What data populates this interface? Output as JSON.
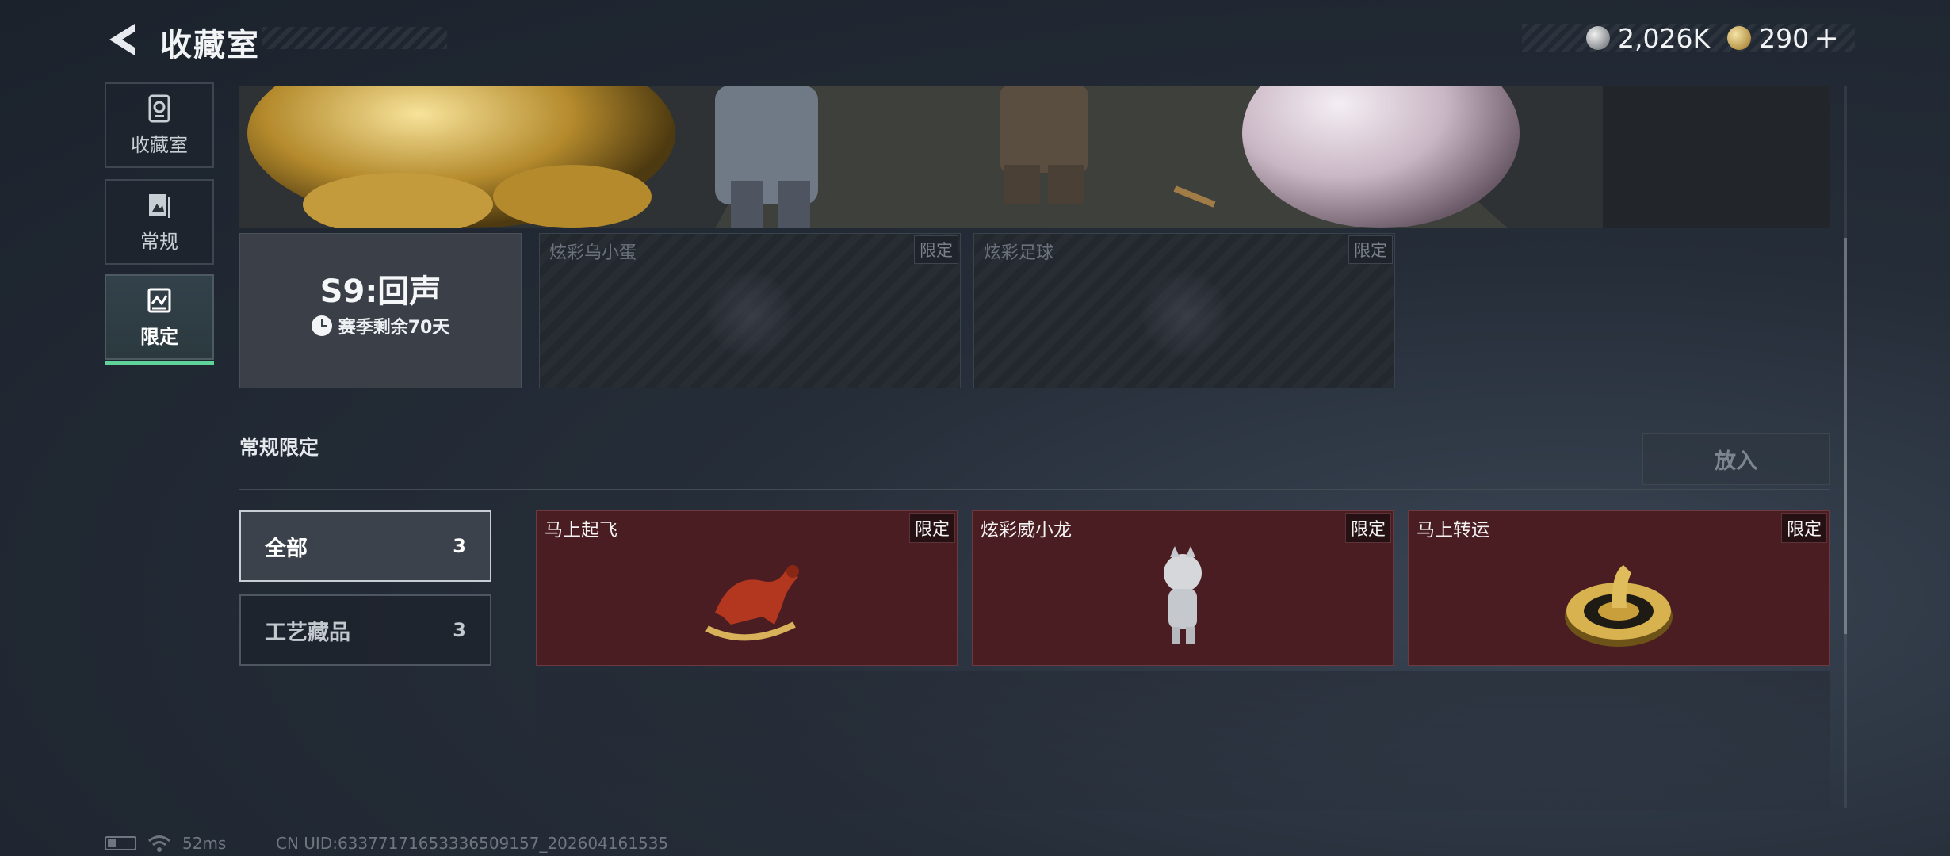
{
  "header": {
    "title": "收藏室",
    "currency": [
      {
        "icon": "silver-coin-icon",
        "value": "2,026K"
      },
      {
        "icon": "gold-coin-icon",
        "value": "290"
      }
    ],
    "add_label": "+"
  },
  "sidebar": {
    "items": [
      {
        "label": "收藏室",
        "icon": "trophy-icon"
      },
      {
        "label": "常规",
        "icon": "gallery-icon"
      },
      {
        "label": "限定",
        "icon": "limited-icon",
        "active": true
      }
    ]
  },
  "season": {
    "name": "S9:回声",
    "remaining": "赛季剩余70天"
  },
  "season_items": [
    {
      "name": "炫彩乌小蛋",
      "tag": "限定"
    },
    {
      "name": "炫彩足球",
      "tag": "限定"
    }
  ],
  "section": {
    "title": "常规限定",
    "place_button": "放入"
  },
  "filters": [
    {
      "label": "全部",
      "count": "3",
      "active": true
    },
    {
      "label": "工艺藏品",
      "count": "3",
      "active": false
    }
  ],
  "items": [
    {
      "name": "马上起飞",
      "tag": "限定",
      "art": "horse-figurine-icon"
    },
    {
      "name": "炫彩威小龙",
      "tag": "限定",
      "art": "dragon-figurine-icon"
    },
    {
      "name": "马上转运",
      "tag": "限定",
      "art": "fortune-wheel-icon"
    }
  ],
  "footer": {
    "ping": "52ms",
    "uid": "CN UID:6337717165333650915​7_202604161535"
  },
  "colors": {
    "accent": "#5fd39a",
    "item_card_bg": "#4a1d22",
    "background": "#252d38"
  }
}
